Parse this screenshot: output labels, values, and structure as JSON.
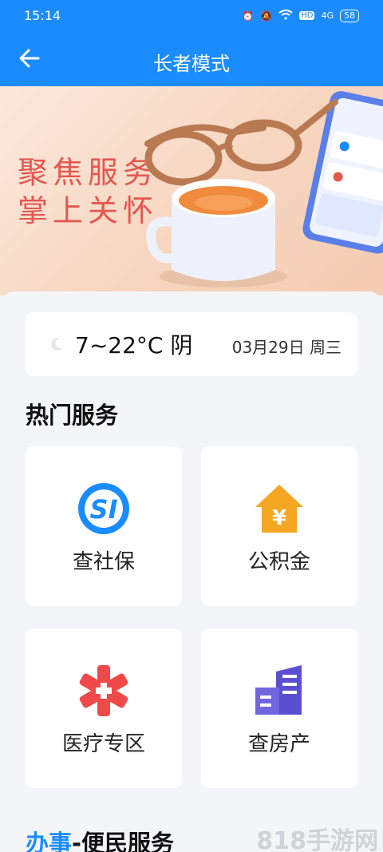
{
  "status_bar": {
    "time": "15:14",
    "network": "4G",
    "hd": "HD",
    "battery": "58"
  },
  "header": {
    "title": "长者模式"
  },
  "banner": {
    "line1": "聚焦服务",
    "line2": "掌上关怀"
  },
  "weather": {
    "temp": "7~22°C 阴",
    "date": "03月29日 周三"
  },
  "hot_services": {
    "title": "热门服务",
    "items": [
      {
        "label": "查社保",
        "icon": "social-security-icon"
      },
      {
        "label": "公积金",
        "icon": "housing-fund-icon"
      },
      {
        "label": "医疗专区",
        "icon": "medical-icon"
      },
      {
        "label": "查房产",
        "icon": "property-icon"
      }
    ]
  },
  "section2": {
    "title_highlight": "办事",
    "title_rest": "-便民服务"
  },
  "watermark": "818手游网",
  "colors": {
    "primary": "#1a8cff",
    "accent_red": "#e5574f",
    "orange": "#f5a623",
    "purple": "#5b4fd1"
  }
}
